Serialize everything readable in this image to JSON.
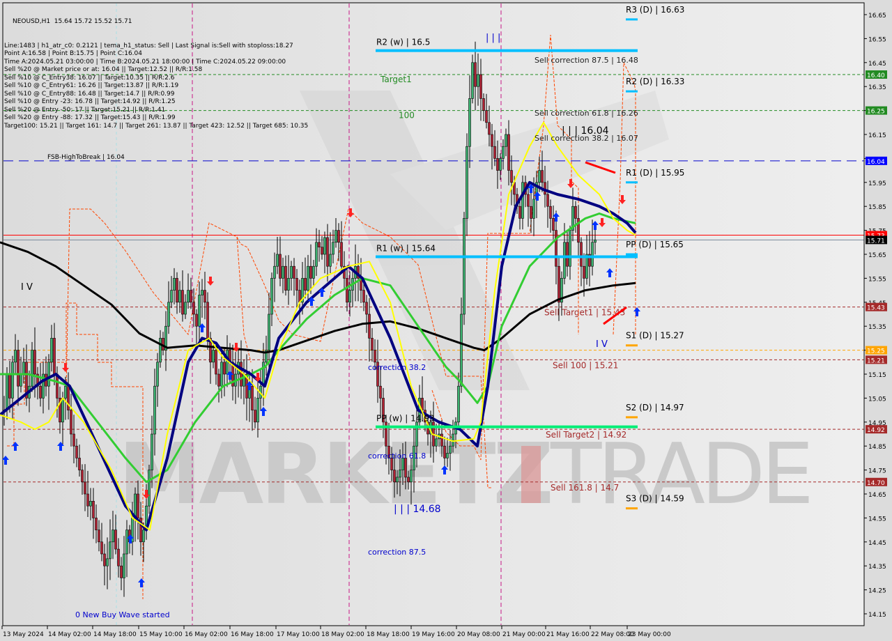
{
  "window": {
    "symbol_line": "NEOUSD,H1  15.64 15.72 15.52 15.71"
  },
  "info_panel": [
    "Line:1483 | h1_atr_c0: 0.2121 | tema_h1_status: Sell | Last Signal is:Sell with stoploss:18.27",
    "Point A:16.58 | Point B:15.75 | Point C:16.04",
    "Time A:2024.05.21 03:00:00 | Time B:2024.05.21 18:00:00 | Time C:2024.05.22 09:00:00",
    "Sell %20 @ Market price or at: 16.04 || Target:12.52 || R/R:1.58",
    "Sell %10 @ C_Entry38: 16.07 || Target:10.35 || R/R:2.6",
    "Sell %10 @ C_Entry61: 16.26 || Target:13.87 || R/R:1.19",
    "Sell %10 @ C_Entry88: 16.48 || Target:14.7 || R/R:0.99",
    "Sell %10 @ Entry -23: 16.78 || Target:14.92 || R/R:1.25",
    "Sell %20 @ Entry -50: 17 || Target:15.21 || R/R:1.41",
    "Sell %20 @ Entry -88: 17.32 || Target:15.43 || R/R:1.99",
    "Target100: 15.21 || Target 161: 14.7 || Target 261: 13.87 || Target 423: 12.52 || Target 685: 10.35"
  ],
  "watermark": {
    "left": "MARKETZ",
    "right": "TRADE"
  },
  "chart_data": {
    "type": "line",
    "title": "NEOUSD,H1",
    "ohlc_last": {
      "open": 15.64,
      "high": 15.72,
      "low": 15.52,
      "close": 15.71
    },
    "ylim": [
      14.1,
      16.7
    ],
    "y_ticks": [
      16.65,
      16.55,
      16.45,
      16.35,
      16.25,
      16.15,
      16.05,
      15.95,
      15.85,
      15.75,
      15.65,
      15.55,
      15.45,
      15.35,
      15.25,
      15.15,
      15.05,
      14.95,
      14.85,
      14.75,
      14.65,
      14.55,
      14.45,
      14.35,
      14.25,
      14.15
    ],
    "x_ticks": [
      "13 May 2024",
      "14 May 02:00",
      "14 May 18:00",
      "15 May 10:00",
      "16 May 02:00",
      "16 May 18:00",
      "17 May 10:00",
      "18 May 02:00",
      "18 May 18:00",
      "19 May 16:00",
      "20 May 08:00",
      "21 May 00:00",
      "21 May 16:00",
      "22 May 08:00",
      "23 May 00:00"
    ],
    "price_tags": [
      {
        "value": "16.40",
        "color": "#228b22"
      },
      {
        "value": "16.25",
        "color": "#228b22"
      },
      {
        "value": "16.04",
        "color": "#0000ff"
      },
      {
        "value": "15.73",
        "color": "#ff0000"
      },
      {
        "value": "15.71",
        "color": "#000000"
      },
      {
        "value": "15.43",
        "color": "#a52a2a"
      },
      {
        "value": "15.25",
        "color": "#ffa500"
      },
      {
        "value": "15.21",
        "color": "#a52a2a"
      },
      {
        "value": "14.92",
        "color": "#a52a2a"
      },
      {
        "value": "14.70",
        "color": "#a52a2a"
      }
    ],
    "hlines": [
      {
        "price": 16.4,
        "color": "#228b22",
        "style": "dash",
        "label": "Target1"
      },
      {
        "price": 16.25,
        "color": "#228b22",
        "style": "dash",
        "label": "100"
      },
      {
        "price": 16.04,
        "color": "#0000cd",
        "style": "longdash",
        "label": "FSB-HighToBreak | 16.04"
      },
      {
        "price": 15.73,
        "color": "#ff0000",
        "style": "solid",
        "label": ""
      },
      {
        "price": 15.71,
        "color": "#778899",
        "style": "solid",
        "label": ""
      },
      {
        "price": 15.43,
        "color": "#a52a2a",
        "style": "dash",
        "label": "Sell Target1 | 15.43"
      },
      {
        "price": 15.25,
        "color": "#ffa500",
        "style": "dash",
        "label": ""
      },
      {
        "price": 15.21,
        "color": "#a52a2a",
        "style": "dash",
        "label": "Sell 100 | 15.21"
      },
      {
        "price": 14.92,
        "color": "#a52a2a",
        "style": "dash",
        "label": "Sell Target2 | 14.92"
      },
      {
        "price": 14.7,
        "color": "#a52a2a",
        "style": "dash",
        "label": "Sell 161.8 | 14.7"
      }
    ],
    "weekly_pivots": [
      {
        "label": "R2 (w) | 16.5",
        "price": 16.5
      },
      {
        "label": "R1 (w) | 15.64",
        "price": 15.64
      },
      {
        "label": "PP (w) | 14.93",
        "price": 14.93
      }
    ],
    "daily_pivots": [
      {
        "label": "R3 (D) | 16.63",
        "price": 16.63
      },
      {
        "label": "R2 (D) | 16.33",
        "price": 16.33
      },
      {
        "label": "R1 (D) | 15.95",
        "price": 15.95
      },
      {
        "label": "PP (D) | 15.65",
        "price": 15.65
      },
      {
        "label": "S1 (D) | 15.27",
        "price": 15.27
      },
      {
        "label": "S2 (D) | 14.97",
        "price": 14.97
      },
      {
        "label": "S3 (D) | 14.59",
        "price": 14.59
      }
    ],
    "annotations": [
      {
        "text": "Sell correction 87.5 | 16.48",
        "price": 16.48
      },
      {
        "text": "Sell correction 61.8 | 16.26",
        "price": 16.26
      },
      {
        "text": "Sell correction 38.2 | 16.07",
        "price": 16.07
      },
      {
        "text": "| | | 16.04",
        "price": 16.04
      },
      {
        "text": "correction 38.2",
        "price": 15.2
      },
      {
        "text": "correction 61.8",
        "price": 14.78
      },
      {
        "text": "correction 87.5",
        "price": 14.4
      },
      {
        "text": "| | | 14.68",
        "price": 14.68
      },
      {
        "text": "I V",
        "price": 15.55
      },
      {
        "text": "I V",
        "price": 15.27
      },
      {
        "text": "| | |",
        "price": 16.55
      },
      {
        "text": "0 New Buy Wave started",
        "price": 14.2
      }
    ],
    "series": [
      {
        "name": "price_close",
        "color": "#000000",
        "x": [
          0,
          4,
          8,
          12,
          16,
          20,
          24,
          28,
          32,
          36,
          40,
          44,
          48,
          52,
          56,
          60,
          64,
          68,
          72,
          76,
          80,
          84,
          88,
          92,
          96,
          100,
          104,
          108,
          112,
          116,
          120,
          124,
          128,
          132,
          136,
          140,
          144,
          148,
          152,
          156,
          160,
          164,
          168,
          172,
          176,
          180,
          184,
          188,
          192,
          196,
          200,
          204,
          208,
          212,
          216,
          220,
          224,
          228,
          232,
          236,
          240,
          244,
          248,
          252,
          256,
          260,
          264,
          268,
          272,
          276,
          280,
          284,
          288,
          292,
          296,
          300,
          304,
          308,
          312,
          316,
          320,
          324,
          328,
          332,
          336,
          340,
          344,
          348,
          352,
          356,
          360,
          364,
          368,
          372,
          376,
          380,
          384,
          388,
          392,
          396,
          400,
          404,
          408,
          412,
          416,
          420,
          424,
          428,
          432,
          436,
          440,
          444,
          448,
          452,
          456,
          460,
          464,
          468,
          472,
          476,
          480,
          484,
          488,
          492,
          496,
          500,
          504,
          508,
          512,
          516,
          520,
          524,
          528,
          532,
          536,
          540,
          544,
          548,
          552,
          556,
          560,
          564,
          568,
          572,
          576,
          580,
          584,
          588,
          592,
          596,
          600,
          604,
          608,
          612,
          616,
          620,
          624,
          628,
          632,
          636,
          640,
          644,
          648,
          652,
          656,
          660,
          664,
          668,
          672,
          676,
          680,
          684,
          688,
          692,
          696,
          700,
          704,
          708,
          712,
          716,
          720,
          724,
          728,
          732,
          736,
          740,
          744,
          748,
          752,
          756,
          760,
          764,
          768,
          772,
          776,
          780,
          784,
          788,
          792,
          796,
          800,
          804,
          808,
          812,
          816,
          820,
          824,
          828,
          832,
          836,
          840,
          844,
          848,
          852,
          856,
          860,
          864,
          868,
          872,
          876,
          880,
          884,
          888,
          892,
          896,
          900,
          904,
          908,
          912
        ],
        "values": [
          15.0,
          15.15,
          15.05,
          15.2,
          15.25,
          15.1,
          15.15,
          15.2,
          15.05,
          15.1,
          15.25,
          15.15,
          15.1,
          15.05,
          15.15,
          15.1,
          15.2,
          15.3,
          15.15,
          15.05,
          14.95,
          15.05,
          15.1,
          15.0,
          14.9,
          14.85,
          14.8,
          14.75,
          14.7,
          14.65,
          14.6,
          14.62,
          14.55,
          14.5,
          14.45,
          14.4,
          14.35,
          14.38,
          14.45,
          14.5,
          14.42,
          14.35,
          14.3,
          14.4,
          14.5,
          14.45,
          14.55,
          14.65,
          14.55,
          14.45,
          14.5,
          14.6,
          14.75,
          14.9,
          15.1,
          15.2,
          15.3,
          15.25,
          15.35,
          15.45,
          15.5,
          15.55,
          15.45,
          15.5,
          15.4,
          15.45,
          15.5,
          15.45,
          15.4,
          15.35,
          15.48,
          15.5,
          15.45,
          15.3,
          15.2,
          15.25,
          15.15,
          15.1,
          15.2,
          15.15,
          15.25,
          15.2,
          15.1,
          15.15,
          15.2,
          15.1,
          15.15,
          15.05,
          15.1,
          15.0,
          14.95,
          15.05,
          15.1,
          15.2,
          15.25,
          15.4,
          15.55,
          15.6,
          15.65,
          15.55,
          15.6,
          15.5,
          15.55,
          15.6,
          15.55,
          15.5,
          15.45,
          15.55,
          15.5,
          15.6,
          15.55,
          15.6,
          15.7,
          15.68,
          15.65,
          15.72,
          15.6,
          15.65,
          15.7,
          15.75,
          15.7,
          15.6,
          15.55,
          15.45,
          15.5,
          15.55,
          15.6,
          15.55,
          15.5,
          15.45,
          15.4,
          15.3,
          15.25,
          15.2,
          15.1,
          15.05,
          14.95,
          14.85,
          14.8,
          14.75,
          14.7,
          14.72,
          14.75,
          14.8,
          14.72,
          14.7,
          14.75,
          14.85,
          14.95,
          15.05,
          15.0,
          14.95,
          14.9,
          14.95,
          14.85,
          14.88,
          14.9,
          14.85,
          14.8,
          14.82,
          14.85,
          14.9,
          14.95,
          15.1,
          15.4,
          15.8,
          16.1,
          16.3,
          16.45,
          16.35,
          16.4,
          16.3,
          16.25,
          16.2,
          16.15,
          16.1,
          16.05,
          16.0,
          16.05,
          16.1,
          16.15,
          16.0,
          15.95,
          15.9,
          15.85,
          15.8,
          15.95,
          15.9,
          15.85,
          15.8,
          15.88,
          15.95,
          16.0,
          15.95,
          15.9,
          15.85,
          15.8,
          15.75,
          15.6,
          15.45,
          15.55,
          15.7,
          15.6,
          15.75,
          15.85,
          15.8,
          15.7,
          15.6,
          15.55,
          15.65,
          15.6,
          15.7,
          15.71
        ]
      },
      {
        "name": "ma_black_slow",
        "color": "#000000",
        "x": [
          0,
          40,
          80,
          120,
          160,
          200,
          240,
          280,
          320,
          360,
          380,
          400,
          440,
          480,
          520,
          560,
          600,
          640,
          680,
          695,
          720,
          760,
          800,
          840,
          880,
          912
        ],
        "values": [
          15.7,
          15.66,
          15.6,
          15.52,
          15.44,
          15.32,
          15.26,
          15.27,
          15.26,
          15.25,
          15.24,
          15.25,
          15.29,
          15.33,
          15.36,
          15.37,
          15.34,
          15.3,
          15.26,
          15.25,
          15.3,
          15.4,
          15.46,
          15.5,
          15.52,
          15.53
        ]
      },
      {
        "name": "ma_green",
        "color": "#32cd32",
        "x": [
          0,
          40,
          80,
          100,
          140,
          180,
          210,
          240,
          280,
          320,
          360,
          380,
          400,
          440,
          480,
          520,
          560,
          600,
          640,
          660,
          685,
          700,
          720,
          760,
          800,
          840,
          860,
          880,
          912
        ],
        "values": [
          15.15,
          15.15,
          15.12,
          15.1,
          14.95,
          14.8,
          14.7,
          14.75,
          14.95,
          15.1,
          15.15,
          15.18,
          15.25,
          15.38,
          15.48,
          15.55,
          15.52,
          15.35,
          15.18,
          15.12,
          15.03,
          15.1,
          15.35,
          15.6,
          15.72,
          15.8,
          15.82,
          15.8,
          15.78
        ]
      },
      {
        "name": "ma_navy",
        "color": "#000080",
        "x": [
          0,
          30,
          60,
          80,
          100,
          140,
          180,
          210,
          240,
          270,
          290,
          310,
          330,
          360,
          380,
          400,
          440,
          480,
          500,
          520,
          560,
          600,
          630,
          660,
          685,
          700,
          720,
          740,
          760,
          780,
          800,
          830,
          860,
          880,
          900,
          912
        ],
        "values": [
          14.98,
          15.05,
          15.12,
          15.15,
          15.1,
          14.85,
          14.6,
          14.5,
          14.8,
          15.2,
          15.3,
          15.28,
          15.2,
          15.15,
          15.1,
          15.3,
          15.45,
          15.55,
          15.6,
          15.55,
          15.3,
          15.0,
          14.95,
          14.92,
          14.85,
          15.1,
          15.6,
          15.85,
          15.95,
          15.92,
          15.9,
          15.88,
          15.85,
          15.82,
          15.78,
          15.74
        ]
      },
      {
        "name": "ma_yellow",
        "color": "#ffff00",
        "x": [
          0,
          30,
          50,
          70,
          90,
          120,
          160,
          190,
          215,
          240,
          270,
          300,
          320,
          350,
          380,
          400,
          430,
          460,
          500,
          530,
          560,
          590,
          620,
          650,
          680,
          690,
          710,
          730,
          760,
          780,
          800,
          830,
          860,
          880,
          900,
          912
        ],
        "values": [
          14.98,
          14.95,
          14.92,
          14.95,
          15.05,
          14.95,
          14.75,
          14.55,
          14.5,
          14.9,
          15.25,
          15.3,
          15.22,
          15.15,
          15.05,
          15.25,
          15.45,
          15.55,
          15.6,
          15.62,
          15.45,
          15.1,
          14.9,
          14.87,
          14.88,
          14.95,
          15.5,
          15.9,
          16.1,
          16.2,
          16.1,
          15.98,
          15.9,
          15.8,
          15.75,
          15.73
        ]
      }
    ]
  }
}
